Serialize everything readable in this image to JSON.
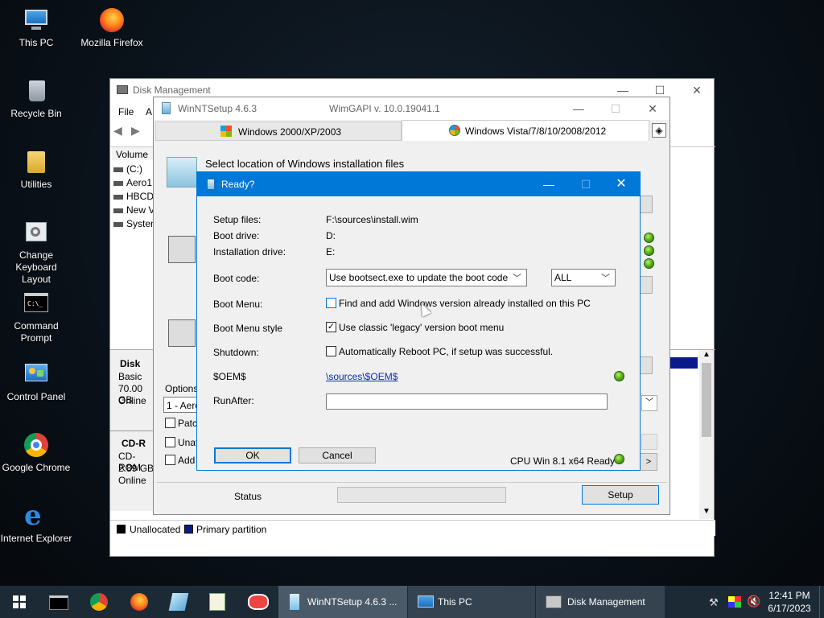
{
  "desktop": {
    "icons": [
      "This PC",
      "Mozilla Firefox",
      "Recycle Bin",
      "Utilities",
      "Change Keyboard Layout",
      "Command Prompt",
      "Control Panel",
      "Google Chrome",
      "Internet Explorer"
    ]
  },
  "disk_mgmt": {
    "title": "Disk Management",
    "menu_file": "File",
    "menu_action": "A",
    "col_volume": "Volume",
    "volumes": [
      "(C:)",
      "Aero1",
      "HBCD",
      "New V",
      "System"
    ],
    "disk0": {
      "name": "Disk",
      "type": "Basic",
      "size": "70.00 GB",
      "status": "Online"
    },
    "cdrom": {
      "name": "CD-R",
      "type": "CD-ROM",
      "size": "2.89 GB",
      "status": "Online"
    },
    "legend_unalloc": "Unallocated",
    "legend_primary": "Primary partition"
  },
  "wnt": {
    "title": "WinNTSetup 4.6.3",
    "wimgapi": "WimGAPI v. 10.0.19041.1",
    "tab1": "Windows 2000/XP/2003",
    "tab2": "Windows Vista/7/8/10/2008/2012",
    "section1": "Select location of Windows installation files",
    "options": "Options",
    "opt_select": "1 - Aero",
    "patch": "Patch",
    "unat": "Unat",
    "add": "Add",
    "status": "Status",
    "setup": "Setup"
  },
  "dialog": {
    "title": "Ready?",
    "setup_files_label": "Setup files:",
    "setup_files_value": "F:\\sources\\install.wim",
    "boot_drive_label": "Boot drive:",
    "boot_drive_value": "D:",
    "install_drive_label": "Installation drive:",
    "install_drive_value": "E:",
    "boot_code_label": "Boot code:",
    "boot_code_select": "Use bootsect.exe to update the boot code",
    "boot_code_target": "ALL",
    "boot_menu_label": "Boot Menu:",
    "boot_menu_option": "Find and add Windows version already installed on this PC",
    "boot_style_label": "Boot Menu style",
    "boot_style_option": "Use classic 'legacy' version boot menu",
    "shutdown_label": "Shutdown:",
    "shutdown_option": "Automatically Reboot PC, if setup was successful.",
    "oem_label": "$OEM$",
    "oem_link": "\\sources\\$OEM$",
    "runafter_label": "RunAfter:",
    "runafter_value": "",
    "ok": "OK",
    "cancel": "Cancel",
    "cpu_status": "CPU Win 8.1 x64 Ready"
  },
  "taskbar": {
    "wnt": "WinNTSetup 4.6.3 ...",
    "thispc": "This PC",
    "diskmgmt": "Disk Management",
    "time": "12:41 PM",
    "date": "6/17/2023"
  }
}
